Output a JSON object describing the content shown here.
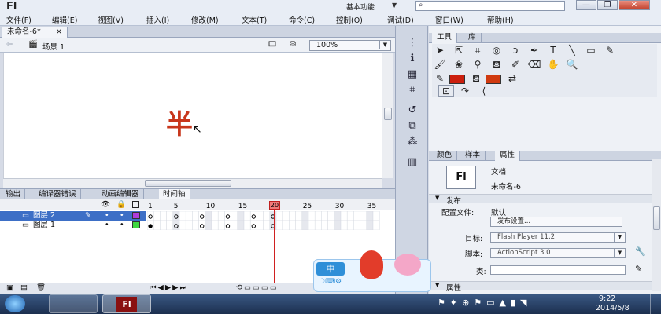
{
  "app": {
    "logo": "Fl",
    "workspace": "基本功能",
    "search_icon": "⌕"
  },
  "window_controls": {
    "minimize": "—",
    "restore": "❐",
    "close": "✕"
  },
  "menu": [
    "文件(F)",
    "编辑(E)",
    "视图(V)",
    "插入(I)",
    "修改(M)",
    "文本(T)",
    "命令(C)",
    "控制(O)",
    "调试(D)",
    "窗口(W)",
    "帮助(H)"
  ],
  "document_tab": {
    "name": "未命名-6*",
    "close": "×"
  },
  "edit_bar": {
    "scene": "场景 1",
    "zoom": "100%"
  },
  "stage": {
    "text": "半",
    "text_color": "#c8361b"
  },
  "bottom_tabs": [
    "输出",
    "编译器错误",
    "动画编辑器",
    "时间轴"
  ],
  "bottom_active_tab": 3,
  "timeline": {
    "frame_numbers": [
      "1",
      "5",
      "10",
      "15",
      "20",
      "25",
      "30",
      "35"
    ],
    "playhead_frame": "20",
    "layers": [
      {
        "name": "图层 2",
        "selected": true,
        "color": "#b03cd9"
      },
      {
        "name": "图层 1",
        "selected": false,
        "color": "#40d840"
      }
    ]
  },
  "right_top_tabs": [
    "工具",
    "库"
  ],
  "right_bottom_tabs": [
    "颜色",
    "样本",
    "属性"
  ],
  "properties": {
    "doc_icon": "Fl",
    "doc_type": "文档",
    "doc_name": "未命名-6",
    "section_publish": "发布",
    "profile_label": "配置文件:",
    "profile_value": "默认",
    "publish_settings_button": "发布设置...",
    "target_label": "目标:",
    "target_value": "Flash Player 11.2",
    "script_label": "脚本:",
    "script_value": "ActionScript 3.0",
    "class_label": "类:",
    "class_value": "",
    "section_properties": "属性"
  },
  "ime": {
    "mode": "中"
  },
  "tray": {
    "time": "9:22",
    "date": "2014/5/8"
  },
  "colors": {
    "stroke": "#cc1f0e",
    "fill": "#d03a10",
    "accent": "#3d6fc6"
  }
}
